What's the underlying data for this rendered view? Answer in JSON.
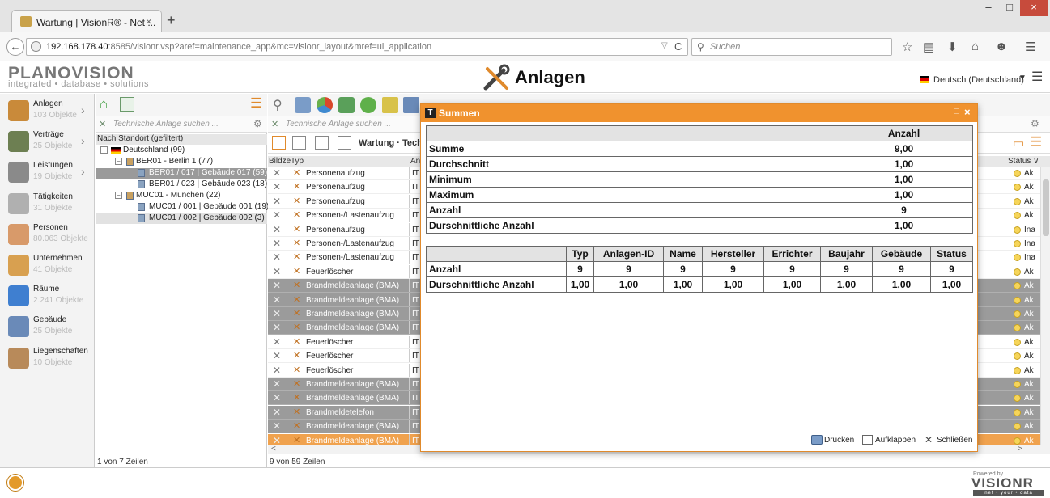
{
  "browser": {
    "tab_title": "Wartung | VisionR® - Net ...",
    "tab_close": "×",
    "new_tab": "+",
    "win_min": "–",
    "win_max": "□",
    "win_close": "×",
    "url_host": "192.168.178.40",
    "url_rest": ":8585/visionr.vsp?aref=maintenance_app&mc=visionr_layout&mref=ui_application",
    "search_placeholder": "Suchen",
    "back": "←",
    "reload": "C",
    "dropdown": "▽"
  },
  "app": {
    "logo_main": "PLANOVISION",
    "logo_sub": "integrated • database • solutions",
    "title": "Anlagen",
    "language": "Deutsch (Deutschland)"
  },
  "sidebar": {
    "items": [
      {
        "label": "Anlagen",
        "count": "103 Objekte",
        "color": "#c98a3a"
      },
      {
        "label": "Verträge",
        "count": "25 Objekte",
        "color": "#6d7f52"
      },
      {
        "label": "Leistungen",
        "count": "19 Objekte",
        "color": "#8a8a8a"
      },
      {
        "label": "Tätigkeiten",
        "count": "31 Objekte",
        "color": "#b0b0b0"
      },
      {
        "label": "Personen",
        "count": "80.063 Objekte",
        "color": "#d89a6a"
      },
      {
        "label": "Unternehmen",
        "count": "41 Objekte",
        "color": "#d8a050"
      },
      {
        "label": "Räume",
        "count": "2.241 Objekte",
        "color": "#3f7fd0"
      },
      {
        "label": "Gebäude",
        "count": "25 Objekte",
        "color": "#6a8ab8"
      },
      {
        "label": "Liegenschaften",
        "count": "10 Objekte",
        "color": "#b88a5a"
      }
    ]
  },
  "tree": {
    "search_placeholder": "Technische Anlage suchen ...",
    "rows": [
      {
        "text": "Nach Standort (gefiltert)",
        "indent": 2,
        "kind": "header"
      },
      {
        "text": "Deutschland (99)",
        "indent": 20,
        "kind": "country"
      },
      {
        "text": "BER01 - Berlin 1 (77)",
        "indent": 38,
        "kind": "site"
      },
      {
        "text": "BER01 / 017 | Gebäude 017 (59)",
        "indent": 66,
        "kind": "building",
        "selected": true
      },
      {
        "text": "BER01 / 023 | Gebäude 023 (18)",
        "indent": 66,
        "kind": "building"
      },
      {
        "text": "MUC01 - München (22)",
        "indent": 38,
        "kind": "site"
      },
      {
        "text": "MUC01 / 001 | Gebäude 001 (19)",
        "indent": 66,
        "kind": "building"
      },
      {
        "text": "MUC01 / 002 | Gebäude 002 (3)",
        "indent": 66,
        "kind": "building",
        "alt": true
      }
    ],
    "status": "1 von 7 Zeilen"
  },
  "grid": {
    "search_placeholder": "Technische Anlage suchen ...",
    "view_label": "Wartung · Techn",
    "col_bild": "Bildze",
    "col_typ": "Typ",
    "col_an": "An",
    "col_status": "Status",
    "rows": [
      {
        "typ": "Personenaufzug",
        "an": "IT",
        "st": "Ak",
        "style": ""
      },
      {
        "typ": "Personenaufzug",
        "an": "IT",
        "st": "Ak",
        "style": ""
      },
      {
        "typ": "Personenaufzug",
        "an": "IT",
        "st": "Ak",
        "style": ""
      },
      {
        "typ": "Personen-/Lastenaufzug",
        "an": "IT",
        "st": "Ak",
        "style": ""
      },
      {
        "typ": "Personenaufzug",
        "an": "IT",
        "st": "Ina",
        "style": ""
      },
      {
        "typ": "Personen-/Lastenaufzug",
        "an": "IT",
        "st": "Ina",
        "style": ""
      },
      {
        "typ": "Personen-/Lastenaufzug",
        "an": "IT",
        "st": "Ina",
        "style": ""
      },
      {
        "typ": "Feuerlöscher",
        "an": "IT",
        "st": "Ak",
        "style": ""
      },
      {
        "typ": "Brandmeldeanlage (BMA)",
        "an": "IT",
        "st": "Ak",
        "style": "gray"
      },
      {
        "typ": "Brandmeldeanlage (BMA)",
        "an": "IT",
        "st": "Ak",
        "style": "gray"
      },
      {
        "typ": "Brandmeldeanlage (BMA)",
        "an": "IT",
        "st": "Ak",
        "style": "gray"
      },
      {
        "typ": "Brandmeldeanlage (BMA)",
        "an": "IT",
        "st": "Ak",
        "style": "gray"
      },
      {
        "typ": "Feuerlöscher",
        "an": "IT",
        "st": "Ak",
        "style": ""
      },
      {
        "typ": "Feuerlöscher",
        "an": "IT",
        "st": "Ak",
        "style": ""
      },
      {
        "typ": "Feuerlöscher",
        "an": "IT",
        "st": "Ak",
        "style": ""
      },
      {
        "typ": "Brandmeldeanlage (BMA)",
        "an": "IT",
        "st": "Ak",
        "style": "gray"
      },
      {
        "typ": "Brandmeldeanlage (BMA)",
        "an": "IT",
        "st": "Ak",
        "style": "gray"
      },
      {
        "typ": "Brandmeldetelefon",
        "an": "IT",
        "st": "Ak",
        "style": "gray"
      },
      {
        "typ": "Brandmeldeanlage (BMA)",
        "an": "IT",
        "st": "Ak",
        "style": "gray"
      },
      {
        "typ": "Brandmeldeanlage (BMA)",
        "an": "IT",
        "st": "Ak",
        "style": "orange"
      }
    ],
    "status": "9 von 59 Zeilen",
    "scroll_left": "<",
    "scroll_right": ">"
  },
  "dialog": {
    "title": "Summen",
    "table1": {
      "header": "Anzahl",
      "rows": [
        {
          "label": "Summe",
          "value": "9,00"
        },
        {
          "label": "Durchschnitt",
          "value": "1,00"
        },
        {
          "label": "Minimum",
          "value": "1,00"
        },
        {
          "label": "Maximum",
          "value": "1,00"
        },
        {
          "label": "Anzahl",
          "value": "9"
        },
        {
          "label": "Durschnittliche Anzahl",
          "value": "1,00"
        }
      ]
    },
    "table2": {
      "headers": [
        "Typ",
        "Anlagen-ID",
        "Name",
        "Hersteller",
        "Errichter",
        "Baujahr",
        "Gebäude",
        "Status"
      ],
      "rows": [
        {
          "label": "Anzahl",
          "values": [
            "9",
            "9",
            "9",
            "9",
            "9",
            "9",
            "9",
            "9"
          ]
        },
        {
          "label": "Durschnittliche Anzahl",
          "values": [
            "1,00",
            "1,00",
            "1,00",
            "1,00",
            "1,00",
            "1,00",
            "1,00",
            "1,00"
          ]
        }
      ]
    },
    "actions": {
      "print": "Drucken",
      "expand": "Aufklappen",
      "close": "Schließen"
    }
  },
  "footer": {
    "powered_by": "Powered by",
    "brand": "VISIONR",
    "tagline": "net • your • data"
  }
}
